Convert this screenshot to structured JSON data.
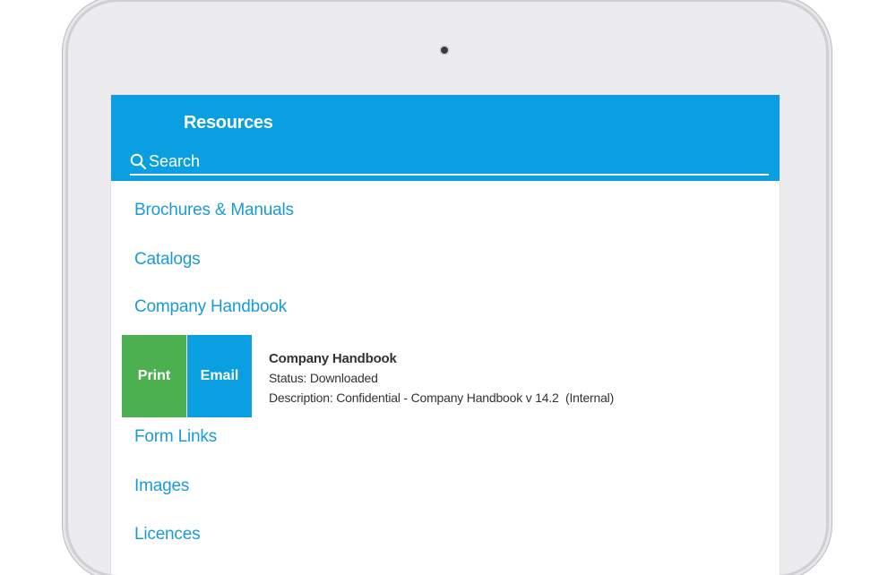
{
  "header": {
    "title": "Resources",
    "search_placeholder": "Search"
  },
  "categories": [
    "Brochures & Manuals",
    "Catalogs",
    "Company Handbook",
    "Form Links",
    "Images",
    "Licences"
  ],
  "document": {
    "actions": {
      "print_label": "Print",
      "email_label": "Email"
    },
    "title": "Company Handbook",
    "status": "Status: Downloaded",
    "description": "Description: Confidential - Company Handbook v 14.2  (Internal)"
  },
  "colors": {
    "header_bg": "#0a9fe0",
    "link": "#1a9bd8",
    "print_bg": "#4caf50",
    "email_bg": "#0a9fe0"
  },
  "icons": {
    "search": "search-icon",
    "camera": "camera-dot"
  }
}
